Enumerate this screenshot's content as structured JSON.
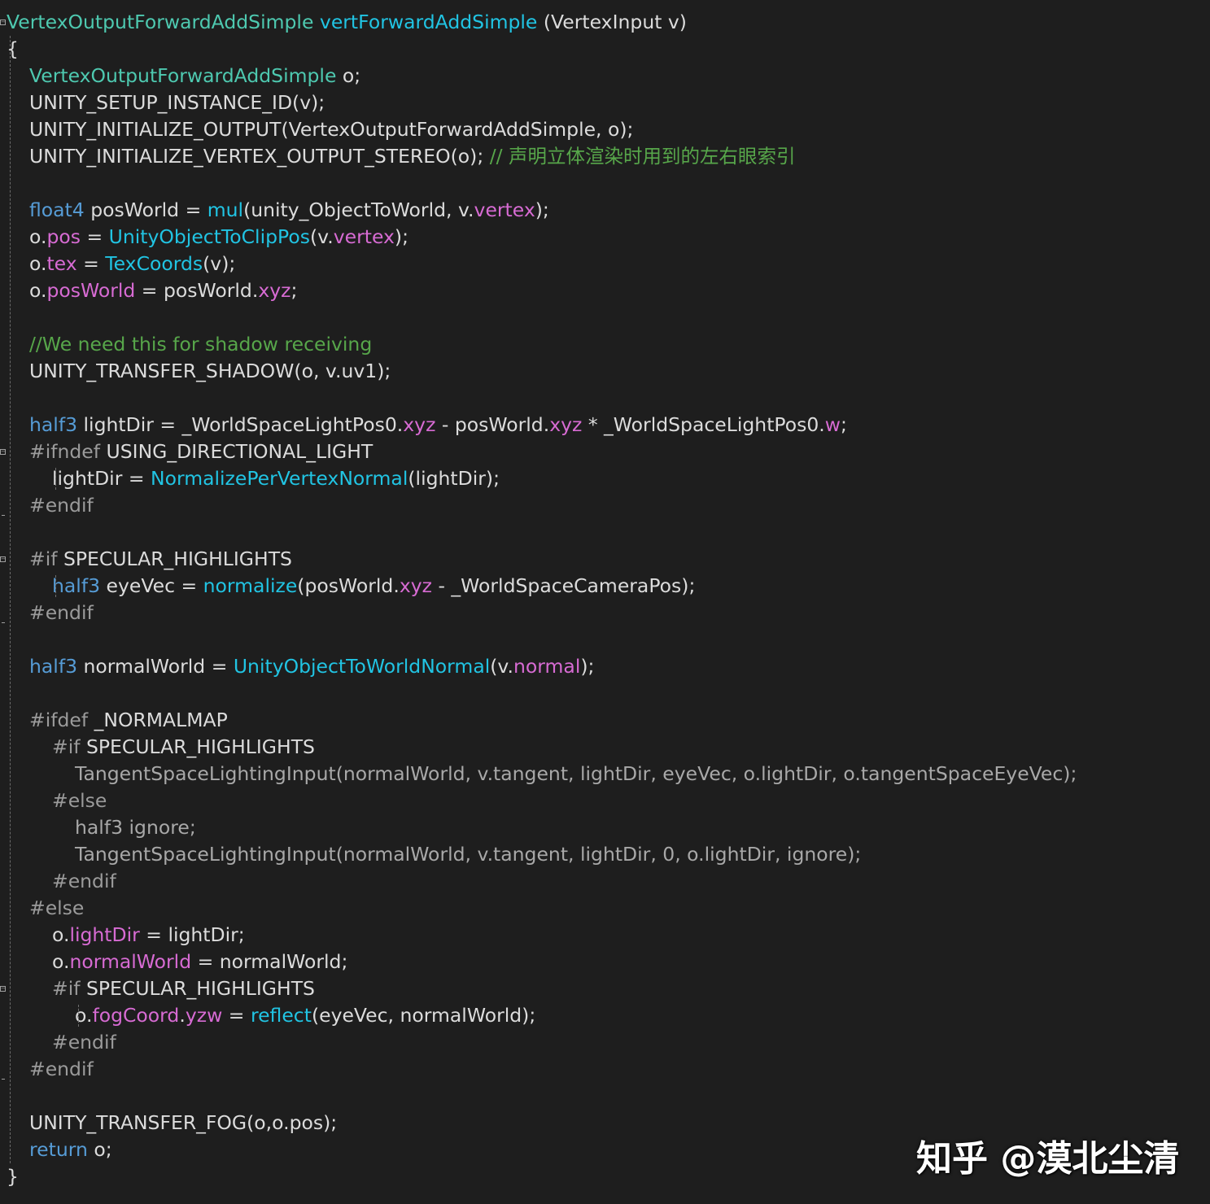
{
  "editor": {
    "colors": {
      "background": "#1e1e1e",
      "plain": "#dcdcdc",
      "type": "#4ec9b0",
      "keyword": "#569cd6",
      "function": "#21c4e3",
      "member": "#d76bd3",
      "comment": "#57a64a",
      "preprocessor": "#9b9b9b",
      "inactive": "#a8a8a8"
    },
    "lines": [
      {
        "indent": 0,
        "tokens": [
          {
            "t": "VertexOutputForwardAddSimple",
            "c": "type"
          },
          {
            "t": " "
          },
          {
            "t": "vertForwardAddSimple",
            "c": "fn"
          },
          {
            "t": " (VertexInput v)"
          }
        ]
      },
      {
        "indent": 0,
        "tokens": [
          {
            "t": "{"
          }
        ]
      },
      {
        "indent": 1,
        "tokens": [
          {
            "t": "VertexOutputForwardAddSimple",
            "c": "type"
          },
          {
            "t": " o;"
          }
        ]
      },
      {
        "indent": 1,
        "tokens": [
          {
            "t": "UNITY_SETUP_INSTANCE_ID(v);"
          }
        ]
      },
      {
        "indent": 1,
        "tokens": [
          {
            "t": "UNITY_INITIALIZE_OUTPUT(VertexOutputForwardAddSimple, o);"
          }
        ]
      },
      {
        "indent": 1,
        "tokens": [
          {
            "t": "UNITY_INITIALIZE_VERTEX_OUTPUT_STEREO(o); "
          },
          {
            "t": "// 声明立体渲染时用到的左右眼索引",
            "c": "cm"
          }
        ]
      },
      {
        "indent": 0,
        "tokens": []
      },
      {
        "indent": 1,
        "tokens": [
          {
            "t": "float4",
            "c": "kw"
          },
          {
            "t": " posWorld = "
          },
          {
            "t": "mul",
            "c": "fn"
          },
          {
            "t": "(unity_ObjectToWorld, v."
          },
          {
            "t": "vertex",
            "c": "mem"
          },
          {
            "t": ");"
          }
        ]
      },
      {
        "indent": 1,
        "tokens": [
          {
            "t": "o."
          },
          {
            "t": "pos",
            "c": "mem"
          },
          {
            "t": " = "
          },
          {
            "t": "UnityObjectToClipPos",
            "c": "fn"
          },
          {
            "t": "(v."
          },
          {
            "t": "vertex",
            "c": "mem"
          },
          {
            "t": ");"
          }
        ]
      },
      {
        "indent": 1,
        "tokens": [
          {
            "t": "o."
          },
          {
            "t": "tex",
            "c": "mem"
          },
          {
            "t": " = "
          },
          {
            "t": "TexCoords",
            "c": "fn"
          },
          {
            "t": "(v);"
          }
        ]
      },
      {
        "indent": 1,
        "tokens": [
          {
            "t": "o."
          },
          {
            "t": "posWorld",
            "c": "mem"
          },
          {
            "t": " = posWorld."
          },
          {
            "t": "xyz",
            "c": "mem"
          },
          {
            "t": ";"
          }
        ]
      },
      {
        "indent": 0,
        "tokens": []
      },
      {
        "indent": 1,
        "tokens": [
          {
            "t": "//We need this for shadow receiving",
            "c": "cm"
          }
        ]
      },
      {
        "indent": 1,
        "tokens": [
          {
            "t": "UNITY_TRANSFER_SHADOW(o, v.uv1);"
          }
        ]
      },
      {
        "indent": 0,
        "tokens": []
      },
      {
        "indent": 1,
        "tokens": [
          {
            "t": "half3",
            "c": "kw"
          },
          {
            "t": " lightDir = _WorldSpaceLightPos0."
          },
          {
            "t": "xyz",
            "c": "mem"
          },
          {
            "t": " - posWorld."
          },
          {
            "t": "xyz",
            "c": "mem"
          },
          {
            "t": " * _WorldSpaceLightPos0."
          },
          {
            "t": "w",
            "c": "mem"
          },
          {
            "t": ";"
          }
        ]
      },
      {
        "indent": 1,
        "tokens": [
          {
            "t": "#ifndef",
            "c": "pp"
          },
          {
            "t": " USING_DIRECTIONAL_LIGHT"
          }
        ]
      },
      {
        "indent": 2,
        "tokens": [
          {
            "t": "lightDir = "
          },
          {
            "t": "NormalizePerVertexNormal",
            "c": "fn"
          },
          {
            "t": "(lightDir);"
          }
        ]
      },
      {
        "indent": 1,
        "tokens": [
          {
            "t": "#endif",
            "c": "pp"
          }
        ]
      },
      {
        "indent": 0,
        "tokens": []
      },
      {
        "indent": 1,
        "tokens": [
          {
            "t": "#if",
            "c": "pp"
          },
          {
            "t": " SPECULAR_HIGHLIGHTS"
          }
        ]
      },
      {
        "indent": 2,
        "tokens": [
          {
            "t": "half3",
            "c": "kw"
          },
          {
            "t": " eyeVec = "
          },
          {
            "t": "normalize",
            "c": "fn"
          },
          {
            "t": "(posWorld."
          },
          {
            "t": "xyz",
            "c": "mem"
          },
          {
            "t": " - _WorldSpaceCameraPos);"
          }
        ]
      },
      {
        "indent": 1,
        "tokens": [
          {
            "t": "#endif",
            "c": "pp"
          }
        ]
      },
      {
        "indent": 0,
        "tokens": []
      },
      {
        "indent": 1,
        "tokens": [
          {
            "t": "half3",
            "c": "kw"
          },
          {
            "t": " normalWorld = "
          },
          {
            "t": "UnityObjectToWorldNormal",
            "c": "fn"
          },
          {
            "t": "(v."
          },
          {
            "t": "normal",
            "c": "mem"
          },
          {
            "t": ");"
          }
        ]
      },
      {
        "indent": 0,
        "tokens": []
      },
      {
        "indent": 1,
        "tokens": [
          {
            "t": "#ifdef",
            "c": "pp"
          },
          {
            "t": " _NORMALMAP"
          }
        ]
      },
      {
        "indent": 2,
        "tokens": [
          {
            "t": "#if",
            "c": "pp"
          },
          {
            "t": " SPECULAR_HIGHLIGHTS"
          }
        ]
      },
      {
        "indent": 3,
        "tokens": [
          {
            "t": "TangentSpaceLightingInput(normalWorld, v.tangent, lightDir, eyeVec, o.lightDir, o.tangentSpaceEyeVec);",
            "c": "dim"
          }
        ]
      },
      {
        "indent": 2,
        "tokens": [
          {
            "t": "#else",
            "c": "pp"
          }
        ]
      },
      {
        "indent": 3,
        "tokens": [
          {
            "t": "half3 ignore;",
            "c": "dim"
          }
        ]
      },
      {
        "indent": 3,
        "tokens": [
          {
            "t": "TangentSpaceLightingInput(normalWorld, v.tangent, lightDir, 0, o.lightDir, ignore);",
            "c": "dim"
          }
        ]
      },
      {
        "indent": 2,
        "tokens": [
          {
            "t": "#endif",
            "c": "pp"
          }
        ]
      },
      {
        "indent": 1,
        "tokens": [
          {
            "t": "#else",
            "c": "pp"
          }
        ]
      },
      {
        "indent": 2,
        "tokens": [
          {
            "t": "o."
          },
          {
            "t": "lightDir",
            "c": "mem"
          },
          {
            "t": " = lightDir;"
          }
        ]
      },
      {
        "indent": 2,
        "tokens": [
          {
            "t": "o."
          },
          {
            "t": "normalWorld",
            "c": "mem"
          },
          {
            "t": " = normalWorld;"
          }
        ]
      },
      {
        "indent": 2,
        "tokens": [
          {
            "t": "#if",
            "c": "pp"
          },
          {
            "t": " SPECULAR_HIGHLIGHTS"
          }
        ]
      },
      {
        "indent": 3,
        "tokens": [
          {
            "t": "o."
          },
          {
            "t": "fogCoord",
            "c": "mem"
          },
          {
            "t": "."
          },
          {
            "t": "yzw",
            "c": "mem"
          },
          {
            "t": " = "
          },
          {
            "t": "reflect",
            "c": "fn"
          },
          {
            "t": "(eyeVec, normalWorld);"
          }
        ]
      },
      {
        "indent": 2,
        "tokens": [
          {
            "t": "#endif",
            "c": "pp"
          }
        ]
      },
      {
        "indent": 1,
        "tokens": [
          {
            "t": "#endif",
            "c": "pp"
          }
        ]
      },
      {
        "indent": 0,
        "tokens": []
      },
      {
        "indent": 1,
        "tokens": [
          {
            "t": "UNITY_TRANSFER_FOG(o,o.pos);"
          }
        ]
      },
      {
        "indent": 1,
        "tokens": [
          {
            "t": "return",
            "c": "kw"
          },
          {
            "t": " o;"
          }
        ]
      },
      {
        "indent": 0,
        "tokens": [
          {
            "t": "}"
          }
        ]
      }
    ]
  },
  "watermark": {
    "text": "知乎 @漠北尘清"
  }
}
